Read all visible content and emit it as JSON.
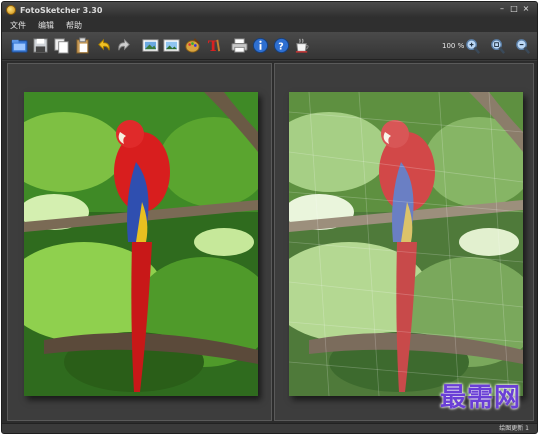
{
  "window": {
    "title": "FotoSketcher 3.30"
  },
  "window_controls": {
    "minimize": "–",
    "maximize": "□",
    "close": "×"
  },
  "menu": {
    "items": [
      "文件",
      "编辑",
      "帮助"
    ]
  },
  "toolbar": {
    "icons": [
      "open-folder-icon",
      "save-icon",
      "copy-icon",
      "paste-icon",
      "undo-icon",
      "redo-icon",
      "image-icon",
      "picture-icon",
      "palette-icon",
      "text-icon",
      "print-icon",
      "info-icon",
      "help-icon",
      "coffee-icon"
    ],
    "zoom_label": "100 %",
    "zoom_icons": [
      "zoom-in-icon",
      "zoom-fit-icon",
      "zoom-out-icon"
    ]
  },
  "watermark": {
    "text": "最需网"
  },
  "status": {
    "text": "绘图更新 1"
  },
  "colors": {
    "window_bg": "#3a3a3a",
    "panel_bg": "#3d3d3d",
    "accent_purple": "#6a3fd6"
  }
}
